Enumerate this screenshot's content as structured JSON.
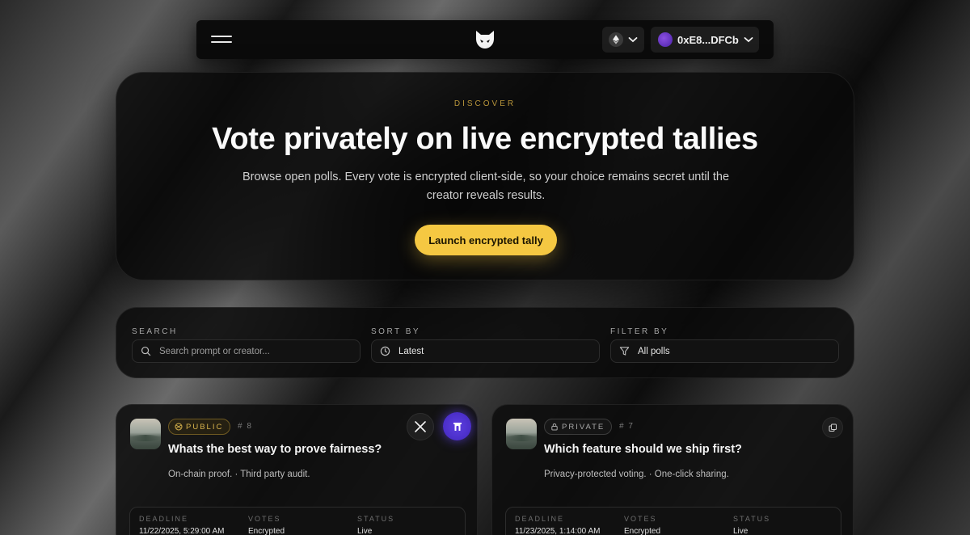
{
  "nav": {
    "menu_icon": "hamburger-icon",
    "logo_icon": "fox-mask-logo",
    "network_icon": "ethereum-icon",
    "wallet_address": "0xE8...DFCb"
  },
  "hero": {
    "eyebrow": "DISCOVER",
    "title": "Vote privately on live encrypted tallies",
    "subtitle": "Browse open polls. Every vote is encrypted client-side, so your choice remains secret until the creator reveals results.",
    "cta_label": "Launch encrypted tally"
  },
  "filters": {
    "search": {
      "label": "SEARCH",
      "placeholder": "Search prompt or creator..."
    },
    "sort": {
      "label": "SORT BY",
      "value": "Latest"
    },
    "filter": {
      "label": "FILTER BY",
      "value": "All polls"
    }
  },
  "polls": [
    {
      "visibility": "PUBLIC",
      "id": "# 8",
      "title": "Whats the best way to prove fairness?",
      "description": "On-chain proof. · Third party audit.",
      "stats": {
        "deadline_label": "DEADLINE",
        "deadline": "11/22/2025, 5:29:00 AM",
        "votes_label": "VOTES",
        "votes": "Encrypted",
        "status_label": "STATUS",
        "status": "Live"
      }
    },
    {
      "visibility": "PRIVATE",
      "id": "# 7",
      "title": "Which feature should we ship first?",
      "description": "Privacy-protected voting. · One-click sharing.",
      "stats": {
        "deadline_label": "DEADLINE",
        "deadline": "11/23/2025, 1:14:00 AM",
        "votes_label": "VOTES",
        "votes": "Encrypted",
        "status_label": "STATUS",
        "status": "Live"
      }
    }
  ],
  "colors": {
    "accent": "#f5c842",
    "farcaster": "#4a2ec8",
    "wallet": "#6a3bd0"
  }
}
